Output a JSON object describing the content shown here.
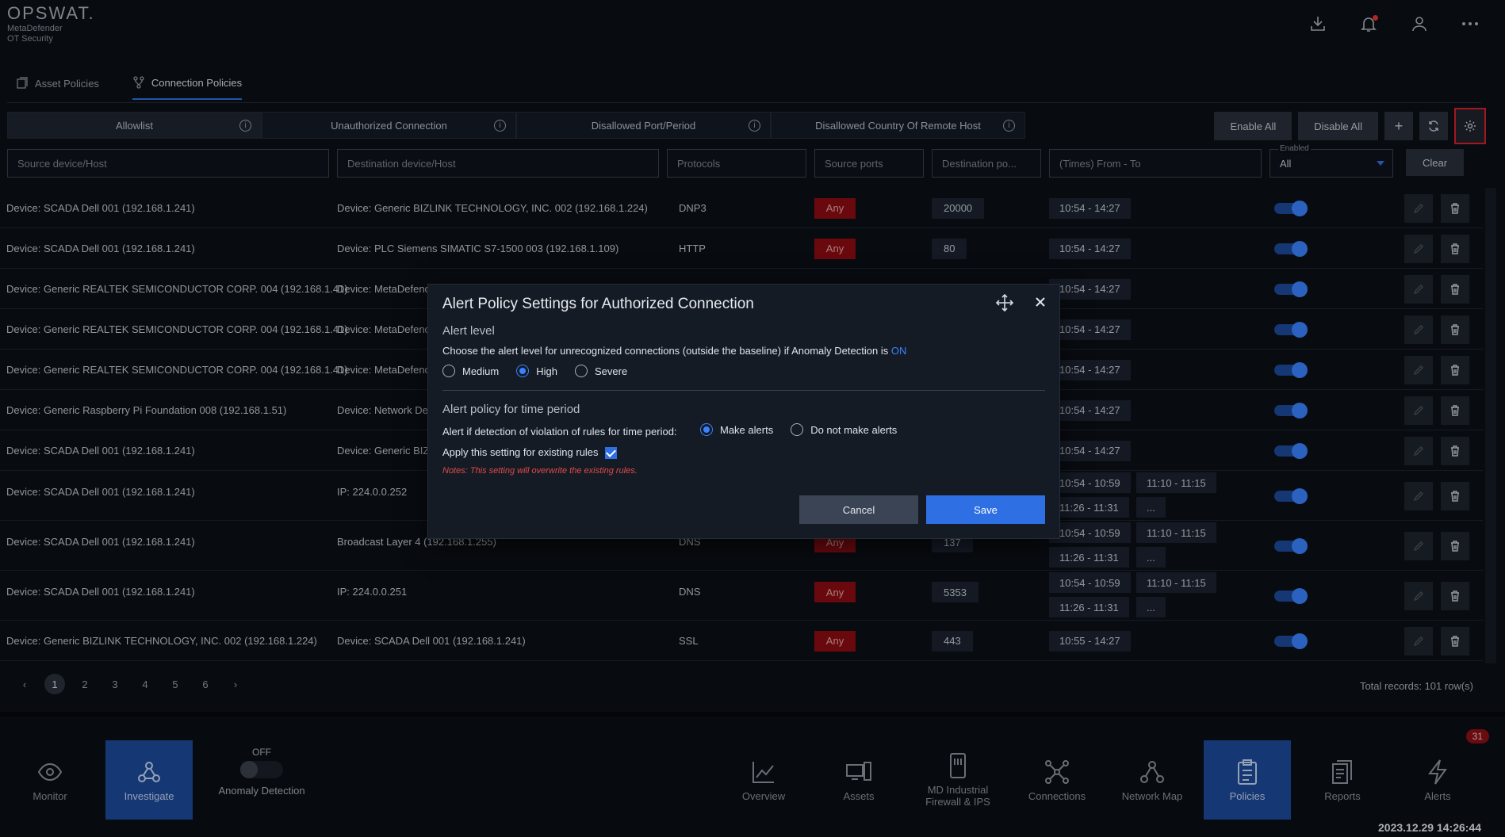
{
  "header": {
    "brand": "OPSWAT.",
    "product_line1": "MetaDefender",
    "product_line2": "OT Security",
    "icons": [
      "download-icon",
      "bell-icon",
      "user-icon",
      "more-icon"
    ]
  },
  "policy_tabs": [
    {
      "label": "Asset Policies",
      "icon": "document-icon",
      "active": false
    },
    {
      "label": "Connection Policies",
      "icon": "branch-icon",
      "active": true
    }
  ],
  "sub_tabs": [
    {
      "label": "Allowlist",
      "active": true
    },
    {
      "label": "Unauthorized Connection",
      "active": false
    },
    {
      "label": "Disallowed Port/Period",
      "active": false
    },
    {
      "label": "Disallowed Country Of Remote Host",
      "active": false
    }
  ],
  "actions": {
    "enable_all": "Enable All",
    "disable_all": "Disable All",
    "add": "+",
    "refresh_icon": "refresh-icon",
    "settings_icon": "gear-icon"
  },
  "filters": {
    "source": "Source device/Host",
    "destination": "Destination device/Host",
    "protocols": "Protocols",
    "source_ports": "Source ports",
    "destination_ports": "Destination po...",
    "times": "(Times) From - To",
    "enabled_label": "Enabled",
    "enabled_value": "All",
    "clear": "Clear"
  },
  "rows": [
    {
      "source": "Device: SCADA Dell 001 (192.168.1.241)",
      "destination": "Device: Generic BIZLINK TECHNOLOGY, INC. 002 (192.168.1.224)",
      "protocol": "DNP3",
      "src_port": "Any",
      "dst_port": "20000",
      "times": [
        "10:54 - 14:27"
      ]
    },
    {
      "source": "Device: SCADA Dell 001 (192.168.1.241)",
      "destination": "Device: PLC Siemens SIMATIC S7-1500 003 (192.168.1.109)",
      "protocol": "HTTP",
      "src_port": "Any",
      "dst_port": "80",
      "times": [
        "10:54 - 14:27"
      ]
    },
    {
      "source": "Device: Generic REALTEK SEMICONDUCTOR CORP. 004 (192.168.1.41)",
      "destination": "Device: MetaDefenc",
      "protocol": "",
      "src_port": "",
      "dst_port": "",
      "times": [
        "10:54 - 14:27"
      ]
    },
    {
      "source": "Device: Generic REALTEK SEMICONDUCTOR CORP. 004 (192.168.1.41)",
      "destination": "Device: MetaDefenc",
      "protocol": "",
      "src_port": "",
      "dst_port": "",
      "times": [
        "10:54 - 14:27"
      ]
    },
    {
      "source": "Device: Generic REALTEK SEMICONDUCTOR CORP. 004 (192.168.1.41)",
      "destination": "Device: MetaDefenc",
      "protocol": "",
      "src_port": "",
      "dst_port": "",
      "times": [
        "10:54 - 14:27"
      ]
    },
    {
      "source": "Device: Generic Raspberry Pi Foundation 008 (192.168.1.51)",
      "destination": "Device: Network De",
      "protocol": "",
      "src_port": "",
      "dst_port": "",
      "times": [
        "10:54 - 14:27"
      ]
    },
    {
      "source": "Device: SCADA Dell 001 (192.168.1.241)",
      "destination": "Device: Generic BIZ",
      "protocol": "",
      "src_port": "",
      "dst_port": "",
      "times": [
        "10:54 - 14:27"
      ]
    },
    {
      "source": "Device: SCADA Dell 001 (192.168.1.241)",
      "destination": "IP: 224.0.0.252",
      "protocol": "",
      "src_port": "",
      "dst_port": "",
      "times": [
        "10:54 - 10:59",
        "11:10 - 11:15",
        "11:26 - 11:31",
        "..."
      ]
    },
    {
      "source": "Device: SCADA Dell 001 (192.168.1.241)",
      "destination": "Broadcast Layer 4 (192.168.1.255)",
      "protocol": "DNS",
      "src_port": "Any",
      "dst_port": "137",
      "times": [
        "10:54 - 10:59",
        "11:10 - 11:15",
        "11:26 - 11:31",
        "..."
      ]
    },
    {
      "source": "Device: SCADA Dell 001 (192.168.1.241)",
      "destination": "IP: 224.0.0.251",
      "protocol": "DNS",
      "src_port": "Any",
      "dst_port": "5353",
      "times": [
        "10:54 - 10:59",
        "11:10 - 11:15",
        "11:26 - 11:31",
        "..."
      ]
    },
    {
      "source": "Device: Generic BIZLINK TECHNOLOGY, INC. 002 (192.168.1.224)",
      "destination": "Device: SCADA Dell 001 (192.168.1.241)",
      "protocol": "SSL",
      "src_port": "Any",
      "dst_port": "443",
      "times": [
        "10:55 - 14:27"
      ]
    }
  ],
  "pagination": {
    "pages": [
      "1",
      "2",
      "3",
      "4",
      "5",
      "6"
    ],
    "current": "1",
    "total": "Total records: 101 row(s)"
  },
  "bottom_nav": {
    "monitor": "Monitor",
    "investigate": "Investigate",
    "anomaly_state": "OFF",
    "anomaly_label": "Anomaly Detection",
    "overview": "Overview",
    "assets": "Assets",
    "md_industrial": "MD Industrial Firewall & IPS",
    "connections": "Connections",
    "network_map": "Network Map",
    "policies": "Policies",
    "reports": "Reports",
    "alerts": "Alerts",
    "alerts_count": "31",
    "datetime": "2023.12.29 14:26:44"
  },
  "modal": {
    "title": "Alert Policy Settings for Authorized Connection",
    "alert_level_title": "Alert level",
    "alert_level_desc": "Choose the alert level for unrecognized connections (outside the baseline) if Anomaly Detection is",
    "anomaly_state": "ON",
    "levels": [
      "Medium",
      "High",
      "Severe"
    ],
    "selected_level": "High",
    "time_period_title": "Alert policy for time period",
    "time_period_desc": "Alert if detection of violation of rules for time period:",
    "make_alerts": "Make alerts",
    "no_alerts": "Do not make alerts",
    "apply_existing": "Apply this setting for existing rules",
    "apply_checked": true,
    "note": "Notes: This setting will overwrite the existing rules.",
    "cancel": "Cancel",
    "save": "Save"
  }
}
